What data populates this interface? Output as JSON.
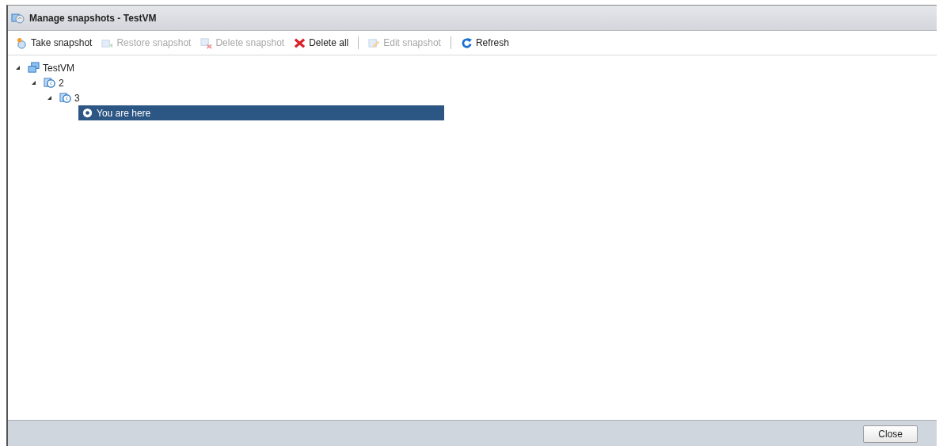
{
  "window": {
    "title": "Manage snapshots - TestVM"
  },
  "toolbar": [
    {
      "kind": "take",
      "label": "Take snapshot",
      "disabled": false
    },
    {
      "kind": "restore",
      "label": "Restore snapshot",
      "disabled": true
    },
    {
      "kind": "delete",
      "label": "Delete snapshot",
      "disabled": true
    },
    {
      "kind": "delete-all",
      "label": "Delete all",
      "disabled": false
    },
    {
      "kind": "separator"
    },
    {
      "kind": "edit",
      "label": "Edit snapshot",
      "disabled": true
    },
    {
      "kind": "separator"
    },
    {
      "kind": "refresh",
      "label": "Refresh",
      "disabled": false
    }
  ],
  "tree": [
    {
      "label": "TestVM",
      "kind": "vm",
      "expanded": true,
      "selected": false,
      "children": [
        {
          "label": "2",
          "kind": "snapshot",
          "expanded": true,
          "selected": false,
          "children": [
            {
              "label": "3",
              "kind": "snapshot",
              "expanded": true,
              "selected": false,
              "children": [
                {
                  "label": "You are here",
                  "kind": "current",
                  "selected": true
                }
              ]
            }
          ]
        }
      ]
    }
  ],
  "footer": {
    "buttons": [
      "Close"
    ]
  }
}
